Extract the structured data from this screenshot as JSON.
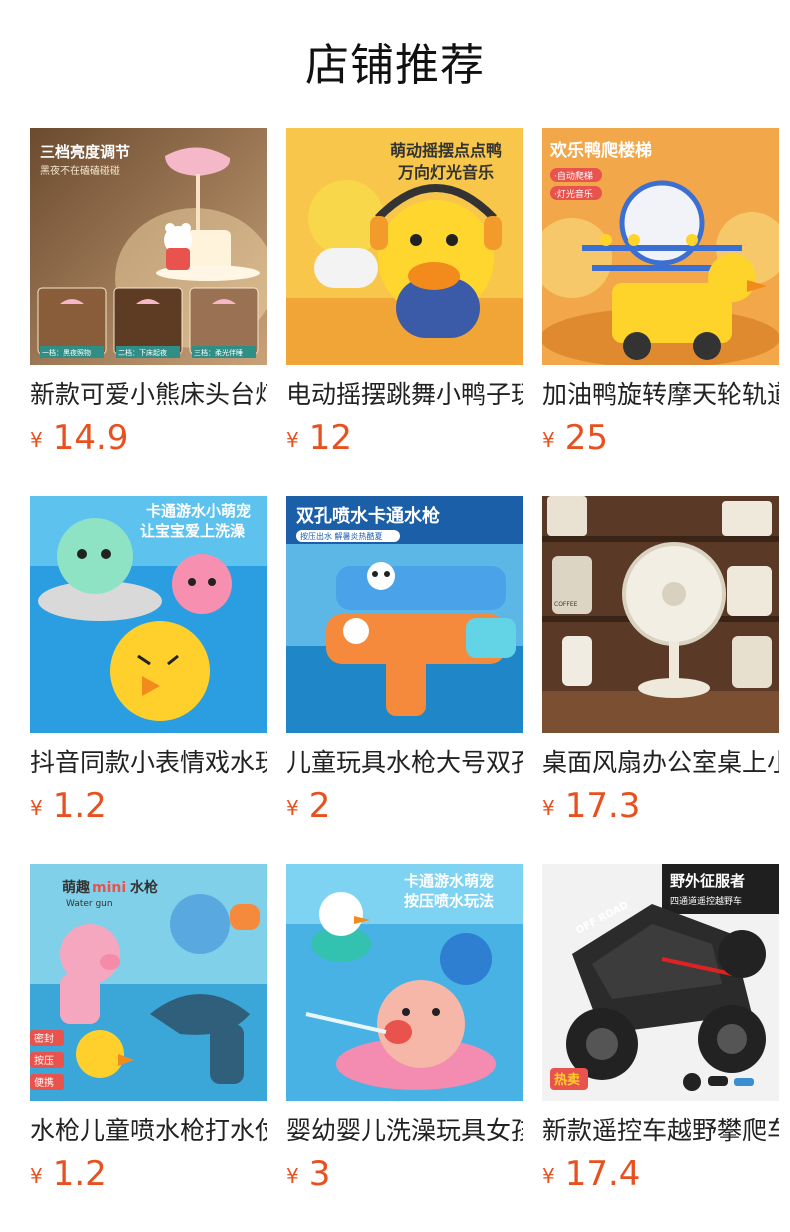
{
  "section": {
    "title": "店铺推荐"
  },
  "colors": {
    "price": "#e8511f",
    "title": "#111111",
    "text": "#222222"
  },
  "products": [
    {
      "name": "新款可爱小熊床头台灯",
      "currency": "¥",
      "price": "14.9",
      "image": {
        "icon": "bear-lamp-image",
        "headline": "三档亮度调节",
        "subline": "黑夜不在磕磕碰碰",
        "tags": [
          "一档：黑夜照物",
          "二档：下床起夜",
          "三档：柔光伴睡"
        ]
      }
    },
    {
      "name": "电动摇摆跳舞小鸭子玩具",
      "currency": "¥",
      "price": "12",
      "image": {
        "icon": "dancing-duck-image",
        "headline": "萌动摇摆点点鸭",
        "subline": "万向灯光音乐"
      }
    },
    {
      "name": "加油鸭旋转摩天轮轨道车",
      "currency": "¥",
      "price": "25",
      "image": {
        "icon": "duck-slide-image",
        "headline": "欢乐鸭爬楼梯",
        "tags": [
          "·自动爬梯",
          "·灯光音乐"
        ]
      }
    },
    {
      "name": "抖音同款小表情戏水玩具",
      "currency": "¥",
      "price": "1.2",
      "image": {
        "icon": "bath-toys-image",
        "headline": "卡通游水小萌宠",
        "subline": "让宝宝爱上洗澡"
      }
    },
    {
      "name": "儿童玩具水枪大号双孔",
      "currency": "¥",
      "price": "2",
      "image": {
        "icon": "water-gun-image",
        "headline": "双孔喷水卡通水枪",
        "subline": "按压出水 解暑炎热酷夏"
      }
    },
    {
      "name": "桌面风扇办公室桌上小风扇",
      "currency": "¥",
      "price": "17.3",
      "image": {
        "icon": "desk-fan-image",
        "shelf_label": "COFFEE"
      }
    },
    {
      "name": "水枪儿童喷水枪打水仗",
      "currency": "¥",
      "price": "1.2",
      "image": {
        "icon": "mini-water-gun-image",
        "headline": "萌趣",
        "headline_accent": "mini",
        "headline_tail": "水枪",
        "subline": "Water gun",
        "tags": [
          "密封",
          "按压",
          "便携"
        ]
      }
    },
    {
      "name": "婴幼婴儿洗澡玩具女孩",
      "currency": "¥",
      "price": "3",
      "image": {
        "icon": "pig-squirt-image",
        "headline": "卡通游水萌宠",
        "subline": "按压喷水玩法"
      }
    },
    {
      "name": "新款遥控车越野攀爬车",
      "currency": "¥",
      "price": "17.4",
      "image": {
        "icon": "rc-car-image",
        "headline": "野外征服者",
        "subline": "四通道遥控越野车",
        "badge": "热卖",
        "car_text": "OFF ROAD"
      }
    }
  ]
}
